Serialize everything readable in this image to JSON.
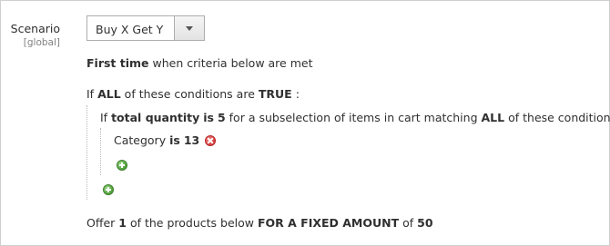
{
  "field": {
    "label": "Scenario",
    "scope": "[global]"
  },
  "select": {
    "value": "Buy X Get Y"
  },
  "first_time": {
    "lead": "First time",
    "rest": "when criteria below are met"
  },
  "conditions": {
    "prefix": "If",
    "aggregator": "ALL",
    "middle": "of these conditions are",
    "value": "TRUE",
    "suffix": ":"
  },
  "subselect": {
    "prefix": "If",
    "attribute": "total quantity",
    "operator": "is",
    "value": "5",
    "middle": "for a subselection of items in cart matching",
    "aggregator": "ALL",
    "suffix": "of these conditions:"
  },
  "category_condition": {
    "attribute": "Category",
    "operator": "is",
    "value": "13"
  },
  "offer": {
    "prefix": "Offer",
    "count": "1",
    "middle": "of the products below",
    "type": "FOR A FIXED AMOUNT",
    "of": "of",
    "amount": "50"
  },
  "icons": {
    "remove": "remove-icon",
    "add": "add-icon",
    "dropdown": "chevron-down-icon"
  },
  "colors": {
    "remove": "#d93b3b",
    "add": "#4f9f3a",
    "border": "#adadad"
  }
}
